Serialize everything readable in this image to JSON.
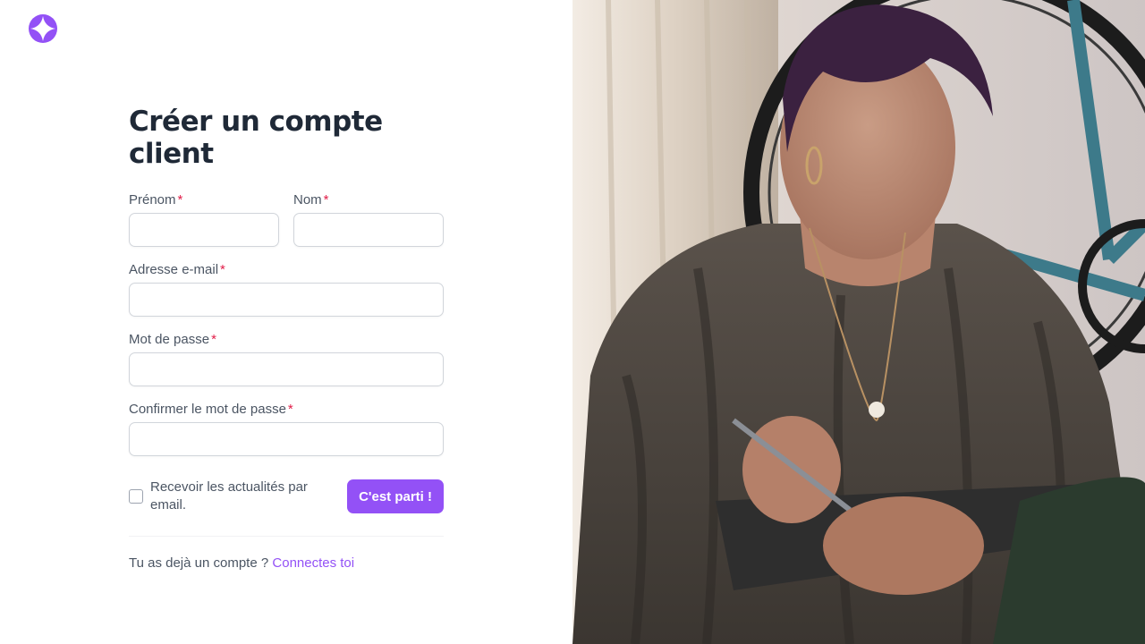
{
  "colors": {
    "accent": "#9351f6",
    "required": "#e11d48",
    "title": "#1f2937",
    "label": "#4b5563"
  },
  "logo": {
    "icon": "four-point-star-logo-icon"
  },
  "form": {
    "title": "Créer un compte client",
    "required_mark": "*",
    "first_name": {
      "label": "Prénom",
      "value": "",
      "placeholder": ""
    },
    "last_name": {
      "label": "Nom",
      "value": "",
      "placeholder": ""
    },
    "email": {
      "label": "Adresse e-mail",
      "value": "",
      "placeholder": ""
    },
    "password": {
      "label": "Mot de passe",
      "value": "",
      "placeholder": ""
    },
    "password_confirm": {
      "label": "Confirmer le mot de passe",
      "value": "",
      "placeholder": ""
    },
    "newsletter": {
      "label": "Recevoir les actualités par email.",
      "checked": false
    },
    "submit_label": "C'est parti !"
  },
  "footer": {
    "prompt": "Tu as dejà un compte ?",
    "link_label": "Connectes toi"
  }
}
